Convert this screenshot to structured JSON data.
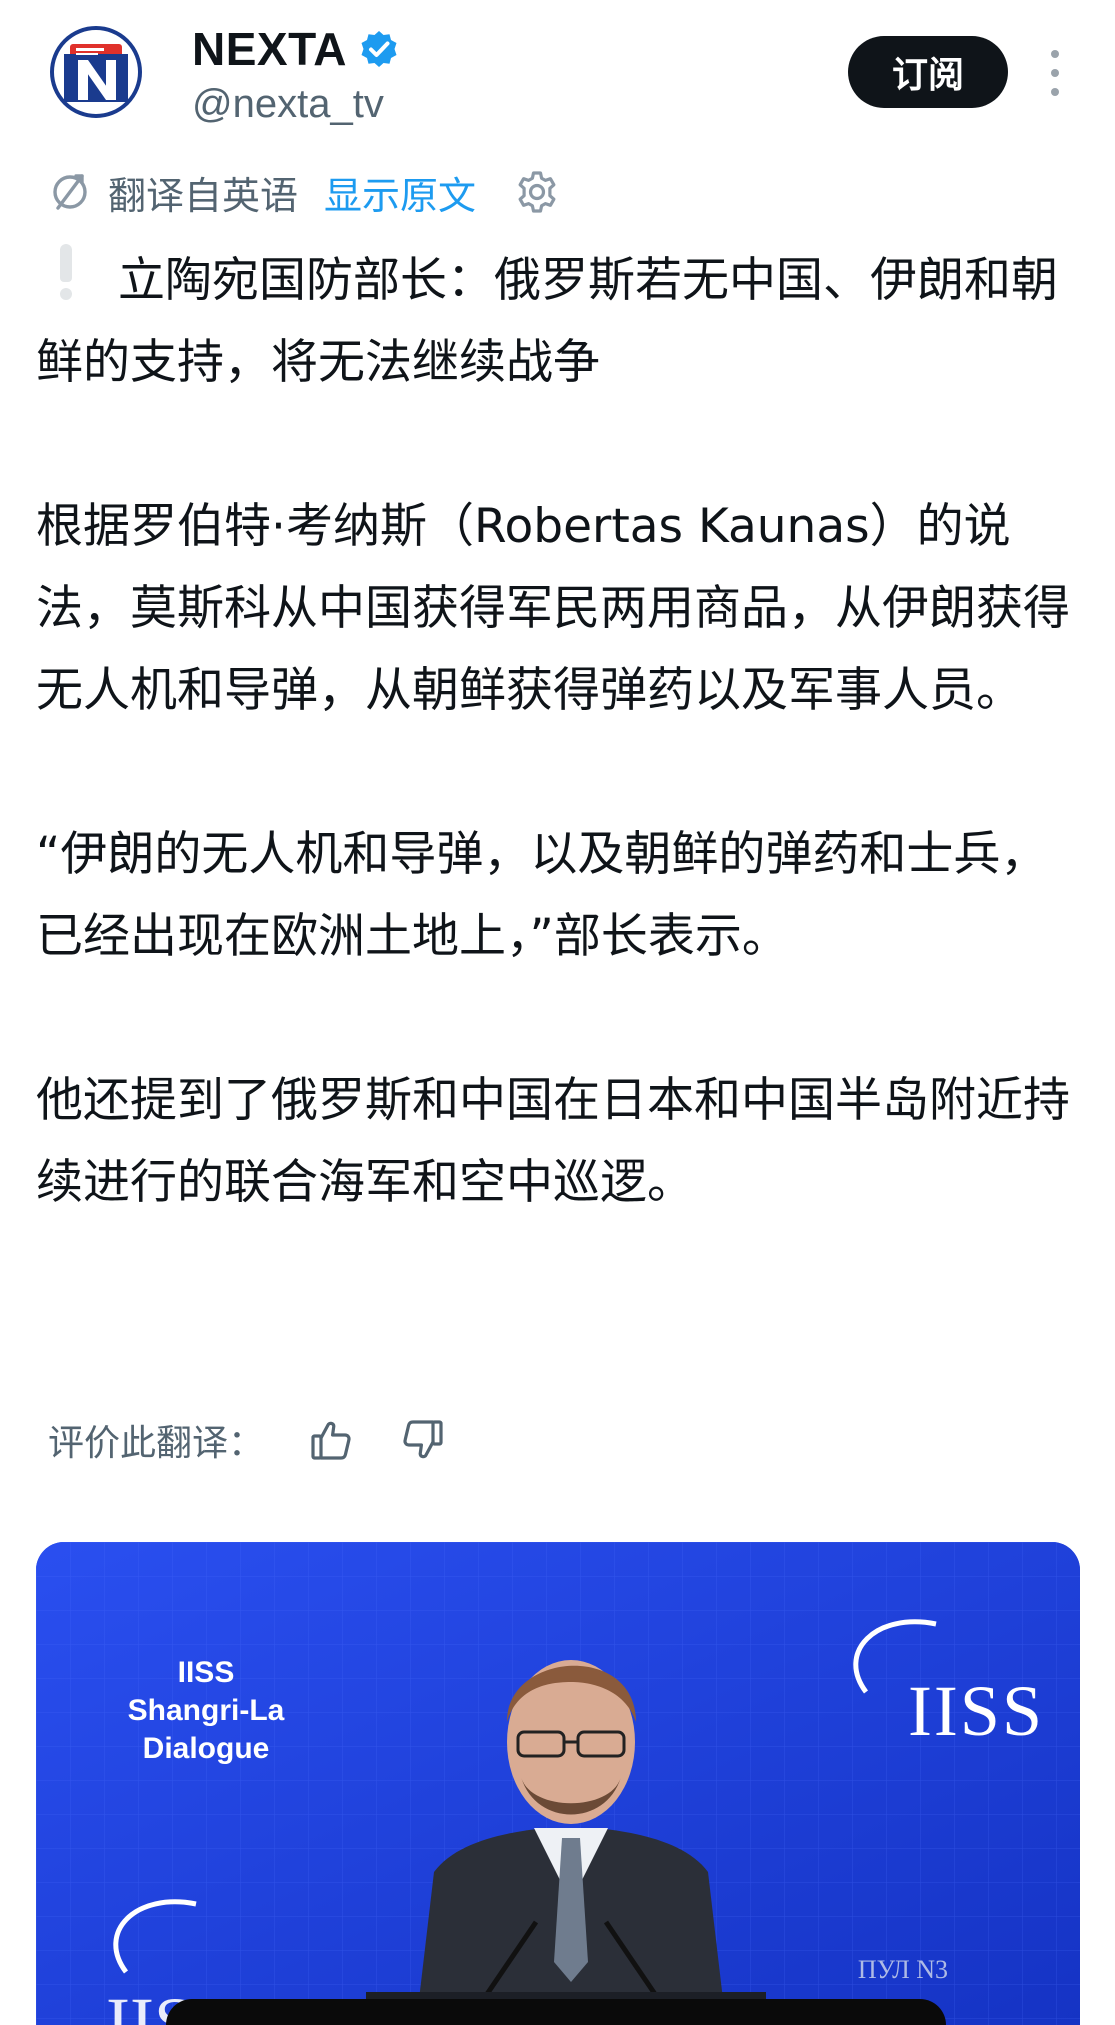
{
  "account": {
    "display_name": "NEXTA",
    "handle": "@nexta_tv",
    "verified": true,
    "avatar_letter": "N",
    "subscribe_label": "订阅"
  },
  "translation": {
    "label": "翻译自英语",
    "show_original_label": "显示原文"
  },
  "tweet": {
    "headline": "立陶宛国防部长：俄罗斯若无中国、伊朗和朝鲜的支持，将无法继续战争",
    "paragraphs": [
      "根据罗伯特·考纳斯（Robertas Kaunas）的说法，莫斯科从中国获得军民两用商品，从伊朗获得无人机和导弹，从朝鲜获得弹药以及军事人员。",
      "“伊朗的无人机和导弹，以及朝鲜的弹药和士兵，已经出现在欧洲土地上，”部长表示。",
      "他还提到了俄罗斯和中国在日本和中国半岛附近持续进行的联合海军和空中巡逻。"
    ]
  },
  "rating": {
    "label": "评价此翻译："
  },
  "media": {
    "event_title_lines": [
      "IISS",
      "Shangri-La",
      "Dialogue"
    ],
    "brand_text": "IISS",
    "brand_text_lower": "IISS",
    "watermark": "ПУЛ N3"
  },
  "colors": {
    "accent": "#1d9bf0",
    "text": "#0f1419",
    "muted": "#536471",
    "button_bg": "#0f1419",
    "media_bg": "#1d3fd6",
    "avatar_red": "#e0312b",
    "avatar_blue": "#1a3b8e"
  },
  "icons": {
    "verified": "verified-badge-icon",
    "translate": "translate-icon",
    "settings": "gear-icon",
    "more": "more-vertical-icon",
    "like": "thumbs-up-icon",
    "dislike": "thumbs-down-icon",
    "alert": "exclamation-icon"
  }
}
